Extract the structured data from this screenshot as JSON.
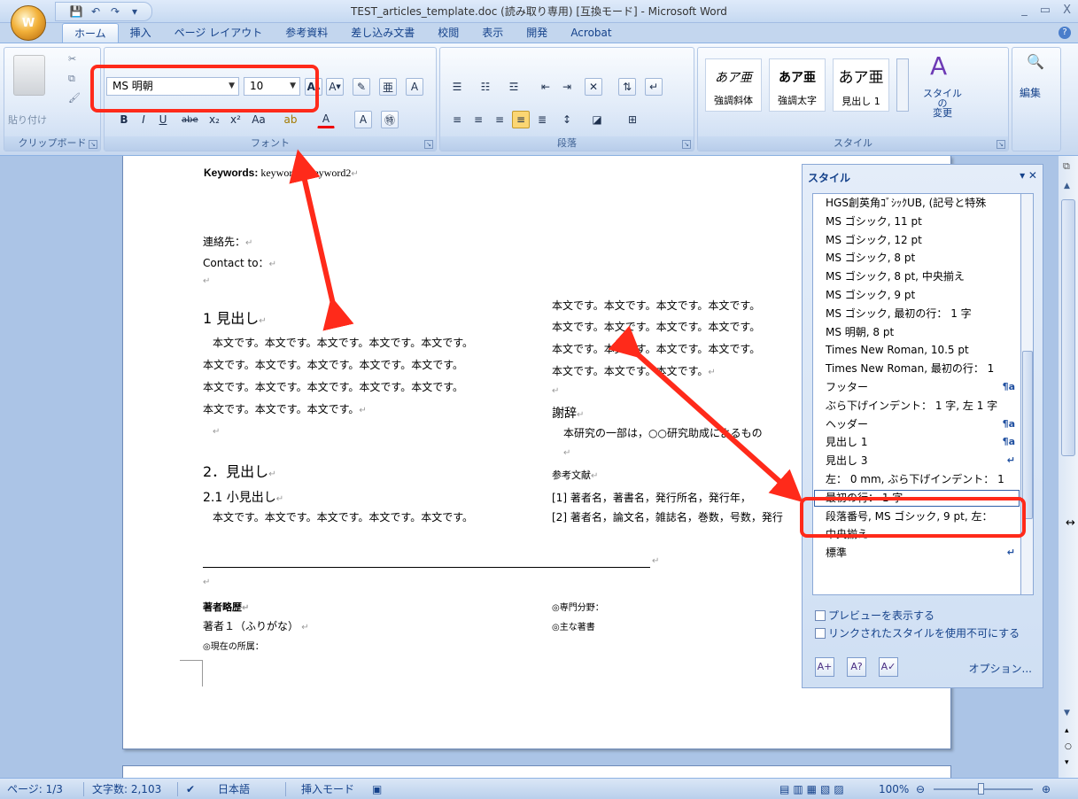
{
  "window": {
    "title": "TEST_articles_template.doc (読み取り専用) [互換モード] - Microsoft Word",
    "controls": [
      "_",
      "▭",
      "X"
    ]
  },
  "office_button": {
    "label": "W"
  },
  "qat": {
    "save_icon": "save-icon",
    "undo_icon": "undo-icon",
    "redo_icon": "redo-icon",
    "customize": "▾"
  },
  "tabs": [
    "ホーム",
    "挿入",
    "ページ レイアウト",
    "参考資料",
    "差し込み文書",
    "校閲",
    "表示",
    "開発",
    "Acrobat"
  ],
  "ribbon": {
    "clipboard": {
      "paste_label": "貼り付け",
      "group_label": "クリップボード"
    },
    "font": {
      "name": "MS 明朝",
      "size": "10",
      "group_label": "フォント"
    },
    "paragraph": {
      "group_label": "段落"
    },
    "styles": {
      "items": [
        {
          "preview": "あア亜",
          "name": "強調斜体"
        },
        {
          "preview": "あア亜",
          "name": "強調太字"
        },
        {
          "preview": "あア亜",
          "name": "見出し 1"
        }
      ],
      "change_label": "スタイルの\n変更",
      "group_label": "スタイル"
    },
    "edit": {
      "label": "編集"
    }
  },
  "document": {
    "keywords_label": "Keywords:",
    "keywords_text": " keyword1, keyword2",
    "contact_ja": "連絡先：",
    "contact_en": "Contact to：",
    "heading1": "1  見出し",
    "left_body": [
      "本文です。本文です。本文です。本文です。本文です。",
      "本文です。本文です。本文です。本文です。本文です。",
      "本文です。本文です。本文です。本文です。本文です。",
      "本文です。本文です。本文です。"
    ],
    "heading2": "2．見出し",
    "heading21": "2.1  小見出し",
    "body21": "本文です。本文です。本文です。本文です。本文です。",
    "right_body": [
      "本文です。本文です。本文です。本文です。",
      "本文です。本文です。本文です。本文です。",
      "本文です。本文です。本文です。本文です。",
      "本文です。本文です。本文です。"
    ],
    "ack_heading": "謝辞",
    "ack_text": "本研究の一部は，○○研究助成によるもの",
    "refs_heading": "参考文献",
    "ref1": "[1]   著者名，著書名，発行所名，発行年，",
    "ref2": "[2]   著者名，論文名，雑誌名，巻数，号数，発行",
    "bio_heading": "著者略歴",
    "author1": "著者１（ふりがな）",
    "affiliation": "◎現在の所属：",
    "field": "◎専門分野：",
    "works": "◎主な著書"
  },
  "styles_pane": {
    "title": "スタイル",
    "items": [
      {
        "name": "HGS創英角ｺﾞｼｯｸUB, (記号と特殊",
        "icon": ""
      },
      {
        "name": "MS ゴシック, 11 pt",
        "icon": ""
      },
      {
        "name": "MS ゴシック, 12 pt",
        "icon": ""
      },
      {
        "name": "MS ゴシック, 8 pt",
        "icon": ""
      },
      {
        "name": "MS ゴシック, 8 pt, 中央揃え",
        "icon": ""
      },
      {
        "name": "MS ゴシック, 9 pt",
        "icon": ""
      },
      {
        "name": "MS ゴシック, 最初の行： 1 字",
        "icon": ""
      },
      {
        "name": "MS 明朝, 8 pt",
        "icon": ""
      },
      {
        "name": "Times New Roman, 10.5 pt",
        "icon": ""
      },
      {
        "name": "Times New Roman, 最初の行： 1",
        "icon": ""
      },
      {
        "name": "フッター",
        "icon": "¶a"
      },
      {
        "name": "ぶら下げインデント： 1 字, 左  1 字",
        "icon": ""
      },
      {
        "name": "ヘッダー",
        "icon": "¶a"
      },
      {
        "name": "見出し 1",
        "icon": "¶a"
      },
      {
        "name": "見出し 3",
        "icon": "↵"
      },
      {
        "name": "左： 0 mm, ぶら下げインデント： 1",
        "icon": ""
      },
      {
        "name": "最初の行： 1 字",
        "icon": ""
      },
      {
        "name": "段落番号, MS ゴシック, 9 pt, 左：",
        "icon": ""
      },
      {
        "name": "中央揃え",
        "icon": ""
      },
      {
        "name": "標準",
        "icon": "↵"
      }
    ],
    "selected_index": 16,
    "show_preview": "プレビューを表示する",
    "disable_linked": "リンクされたスタイルを使用不可にする",
    "options": "オプション..."
  },
  "status_bar": {
    "page": "ページ: 1/3",
    "word_count": "文字数: 2,103",
    "language": "日本語",
    "mode": "挿入モード",
    "zoom": "100%"
  },
  "colors": {
    "highlight": "#ff2a1a",
    "ribbon": "#dde8f7",
    "doc_bg": "#abc4e6"
  }
}
